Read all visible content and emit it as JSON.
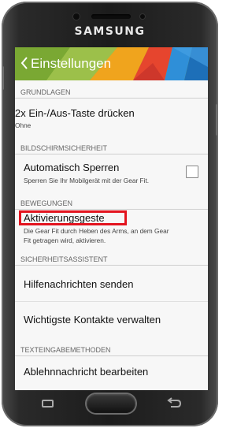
{
  "device": {
    "brand": "SAMSUNG"
  },
  "header": {
    "title": "Einstellungen",
    "back_icon": "chevron-left-icon"
  },
  "sections": {
    "grundlagen": "GRUNDLAGEN",
    "bildschirm": "BILDSCHIRMSICHERHEIT",
    "bewegungen": "BEWEGUNGEN",
    "sicherheit": "SICHERHEITSASSISTENT",
    "texteingabe": "TEXTEINGABEMETHODEN"
  },
  "items": {
    "taste": {
      "title": "2x Ein-/Aus-Taste drücken",
      "subtitle": "Ohne"
    },
    "sperren": {
      "title": "Automatisch Sperren",
      "subtitle": "Sperren Sie Ihr Mobilgerät mit der Gear Fit.",
      "checked": false
    },
    "geste": {
      "title": "Aktivierungsgeste",
      "subtitle_line1": "Die Gear Fit durch Heben des Arms, an dem Gear",
      "subtitle_line2": "Fit getragen wird, aktivieren."
    },
    "hilfe": {
      "title": "Hilfenachrichten senden"
    },
    "kontakte": {
      "title": "Wichtigste Kontakte verwalten"
    },
    "ablehn": {
      "title": "Ablehnnachricht bearbeiten"
    }
  },
  "annotation": {
    "color": "#e3141f"
  },
  "navbar": {
    "recent_icon": "recent-apps-icon",
    "home_icon": "home-button-icon",
    "back_icon": "back-arrow-icon"
  }
}
